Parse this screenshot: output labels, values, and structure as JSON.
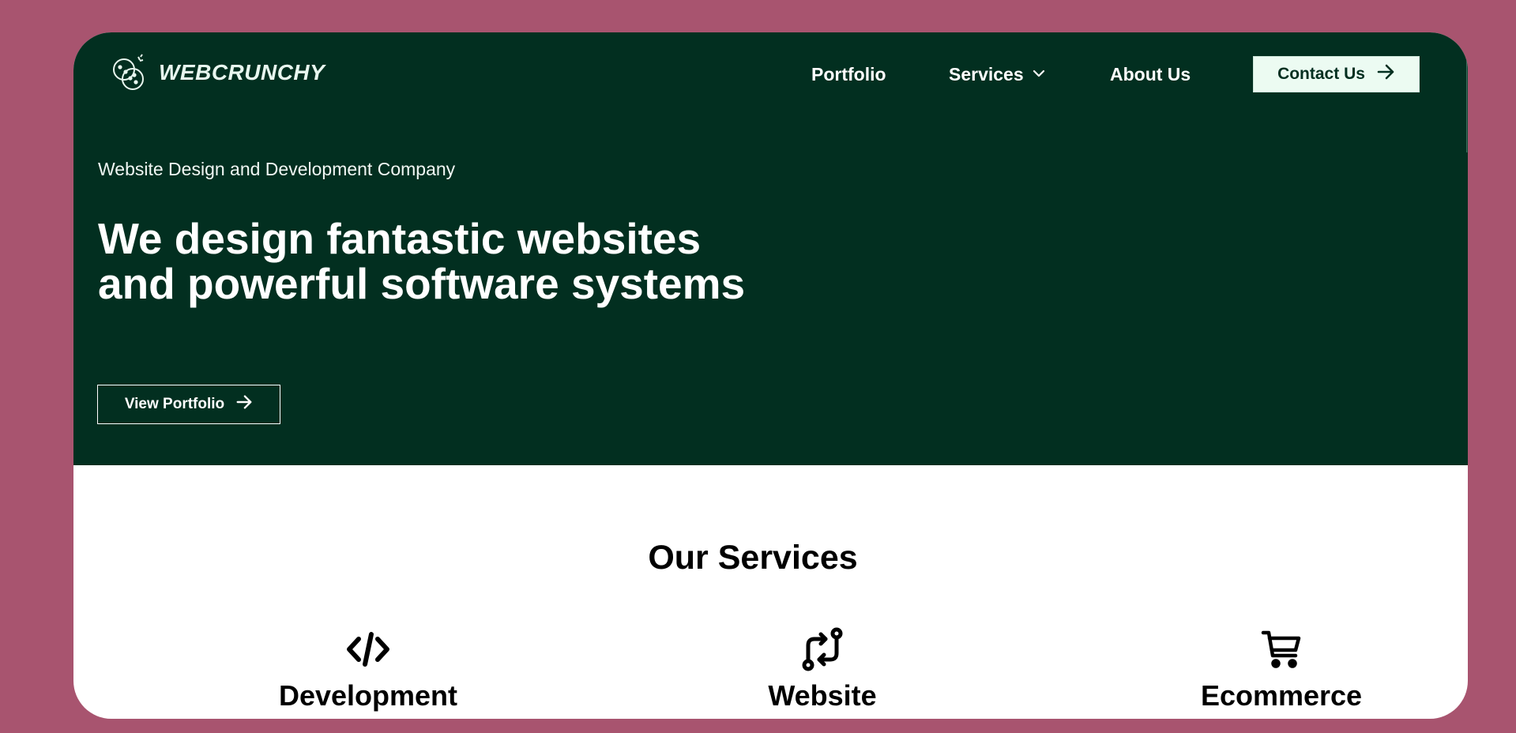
{
  "colors": {
    "page_background": "#a8546f",
    "hero_background": "#022f20",
    "contact_button_background": "#ecfbf2",
    "text_light": "#ffffff",
    "text_dark": "#000000"
  },
  "header": {
    "logo_text": "WEBCRUNCHY",
    "logo_icon": "cookie-icon",
    "nav": {
      "portfolio": "Portfolio",
      "services": "Services",
      "services_icon": "chevron-down-icon",
      "about": "About Us"
    },
    "contact_button": {
      "label": "Contact Us",
      "icon": "arrow-right-icon"
    }
  },
  "hero": {
    "eyebrow": "Website Design and Development Company",
    "headline": "We design fantastic websites and powerful software systems",
    "cta": {
      "label": "View Portfolio",
      "icon": "arrow-right-icon"
    }
  },
  "services": {
    "title": "Our Services",
    "items": [
      {
        "title": "Development",
        "icon": "code-icon"
      },
      {
        "title": "Website",
        "icon": "git-compare-icon"
      },
      {
        "title": "Ecommerce",
        "icon": "shopping-cart-icon"
      }
    ]
  }
}
